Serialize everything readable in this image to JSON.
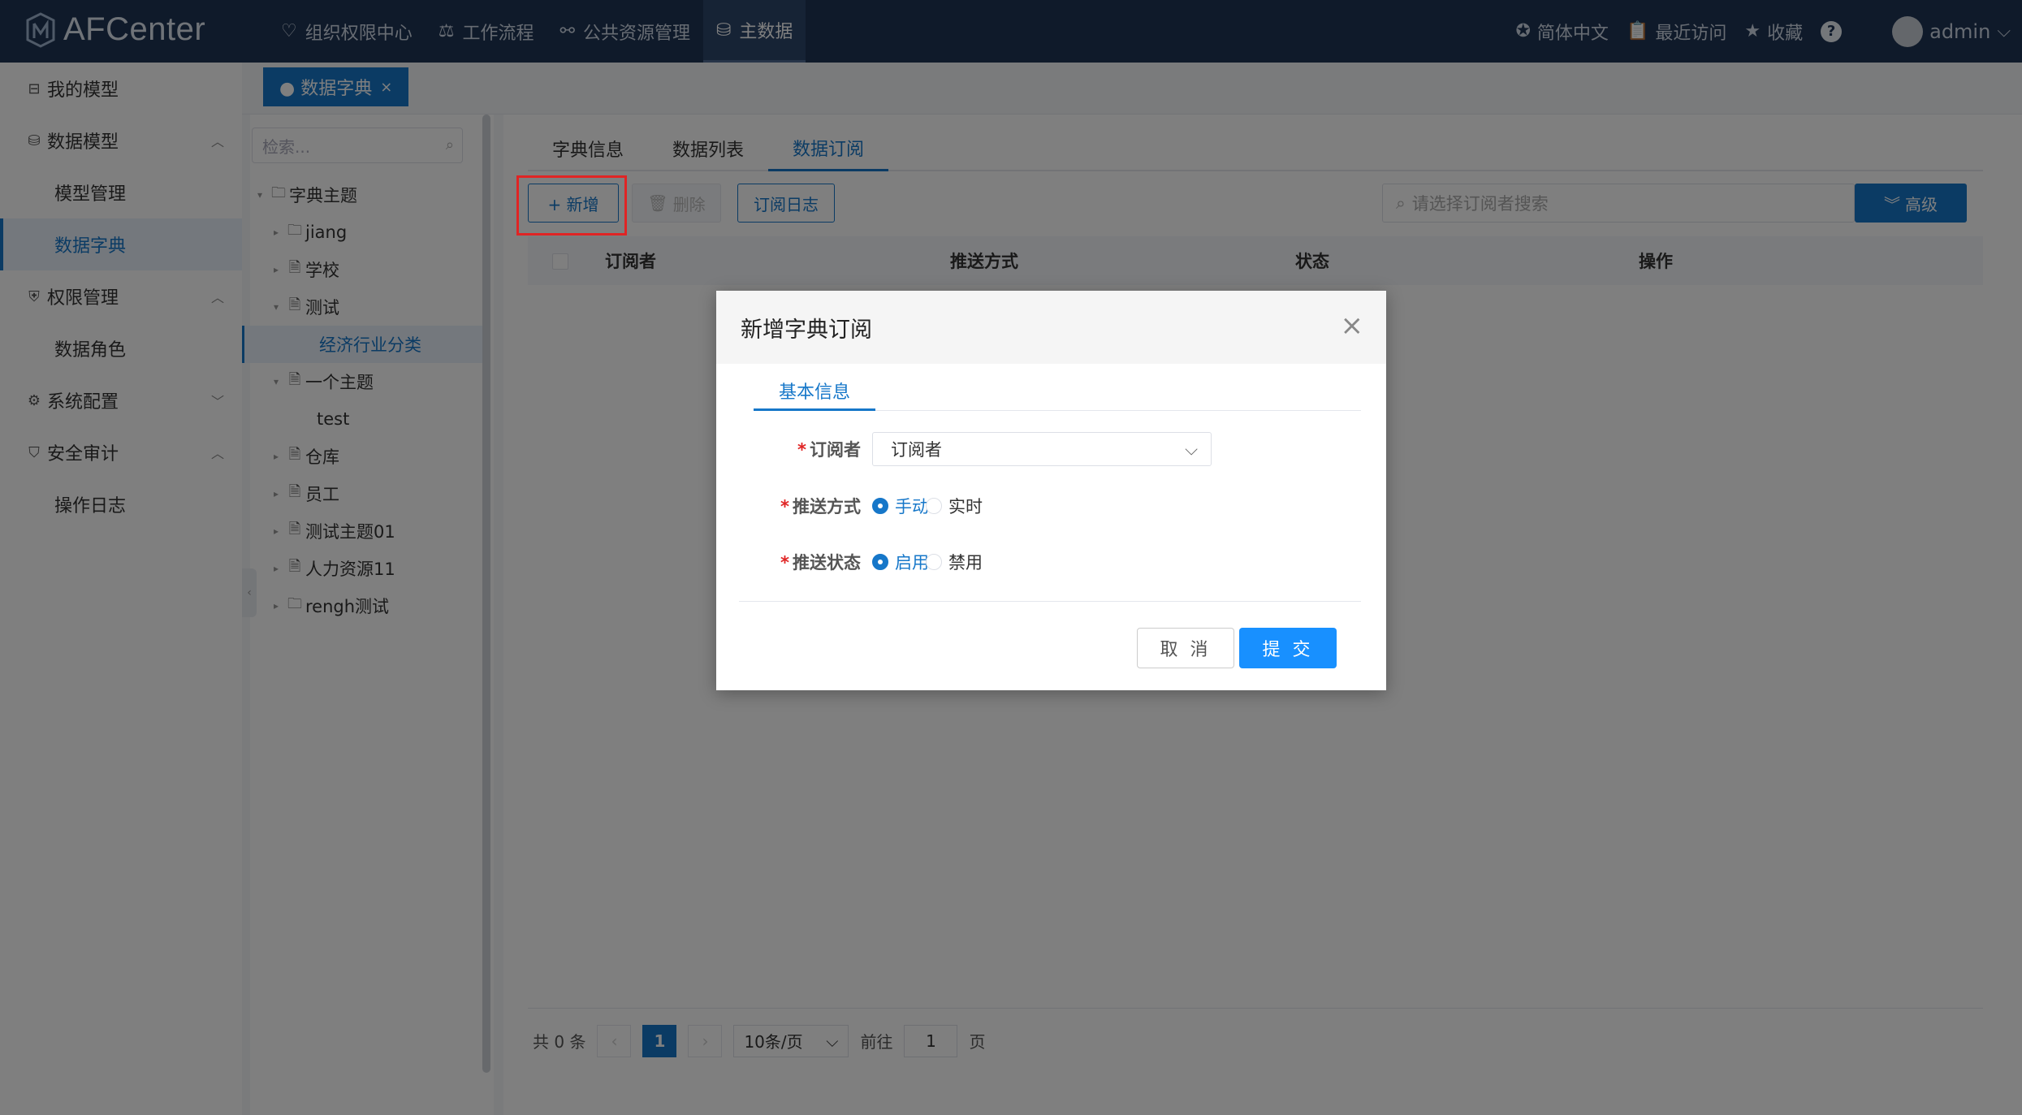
{
  "app": {
    "logo_text": "AFCenter"
  },
  "topnav": [
    {
      "label": "组织权限中心",
      "icon": "shield-heart-icon",
      "active": false
    },
    {
      "label": "工作流程",
      "icon": "scale-icon",
      "active": false
    },
    {
      "label": "公共资源管理",
      "icon": "binoculars-icon",
      "active": false
    },
    {
      "label": "主数据",
      "icon": "data-bars-icon",
      "active": true
    }
  ],
  "topright": {
    "language": "简体中文",
    "recent": "最近访问",
    "favorites": "收藏",
    "help": "?",
    "user": "admin"
  },
  "sidebar": {
    "items": [
      {
        "label": "我的模型",
        "type": "top",
        "icon": "model-icon"
      },
      {
        "label": "数据模型",
        "type": "group",
        "icon": "database-icon",
        "expanded": true
      },
      {
        "label": "模型管理",
        "type": "sub"
      },
      {
        "label": "数据字典",
        "type": "sub",
        "active": true
      },
      {
        "label": "权限管理",
        "type": "group",
        "icon": "shield-icon",
        "expanded": true
      },
      {
        "label": "数据角色",
        "type": "sub"
      },
      {
        "label": "系统配置",
        "type": "group",
        "icon": "gear-icon",
        "expanded": false
      },
      {
        "label": "安全审计",
        "type": "group",
        "icon": "security-icon",
        "expanded": true
      },
      {
        "label": "操作日志",
        "type": "sub"
      }
    ]
  },
  "page_tab": {
    "label": "● 数据字典",
    "close": "×"
  },
  "tree": {
    "search_placeholder": "检索...",
    "nodes": [
      {
        "label": "字典主题",
        "level": 0,
        "icon": "folder-icon",
        "expanded": true
      },
      {
        "label": "jiang",
        "level": 1,
        "icon": "folder-icon"
      },
      {
        "label": "学校",
        "level": 1,
        "icon": "document-icon"
      },
      {
        "label": "测试",
        "level": 1,
        "icon": "document-icon",
        "expanded": true
      },
      {
        "label": "经济行业分类",
        "level": 2,
        "selected": true
      },
      {
        "label": "一个主题",
        "level": 1,
        "icon": "document-icon",
        "expanded": true
      },
      {
        "label": "test",
        "level": 2
      },
      {
        "label": "仓库",
        "level": 1,
        "icon": "document-icon"
      },
      {
        "label": "员工",
        "level": 1,
        "icon": "document-icon"
      },
      {
        "label": "测试主题01",
        "level": 1,
        "icon": "document-icon"
      },
      {
        "label": "人力资源11",
        "level": 1,
        "icon": "document-icon"
      },
      {
        "label": "rengh测试",
        "level": 1,
        "icon": "folder-icon"
      }
    ]
  },
  "content": {
    "tabs": [
      {
        "label": "字典信息",
        "active": false
      },
      {
        "label": "数据列表",
        "active": false
      },
      {
        "label": "数据订阅",
        "active": true
      }
    ],
    "toolbar": {
      "add": "+ 新增",
      "delete": "删除",
      "log": "订阅日志",
      "search_placeholder": "请选择订阅者搜索",
      "advanced": "高级"
    },
    "table": {
      "columns": [
        "订阅者",
        "推送方式",
        "状态",
        "操作"
      ]
    },
    "pager": {
      "total": "共 0 条",
      "current": "1",
      "page_size": "10条/页",
      "goto_prefix": "前往",
      "goto_value": "1",
      "goto_suffix": "页"
    }
  },
  "modal": {
    "title": "新增字典订阅",
    "tab": "基本信息",
    "fields": {
      "subscriber": {
        "label": "订阅者",
        "value": "订阅者"
      },
      "push_method": {
        "label": "推送方式",
        "options": [
          "手动",
          "实时"
        ],
        "selected": "手动"
      },
      "push_status": {
        "label": "推送状态",
        "options": [
          "启用",
          "禁用"
        ],
        "selected": "启用"
      }
    },
    "cancel": "取 消",
    "submit": "提 交"
  },
  "colors": {
    "topbar": "#1f3555",
    "accent": "#1677c9",
    "submit": "#1890ff",
    "highlight": "#e02424"
  }
}
